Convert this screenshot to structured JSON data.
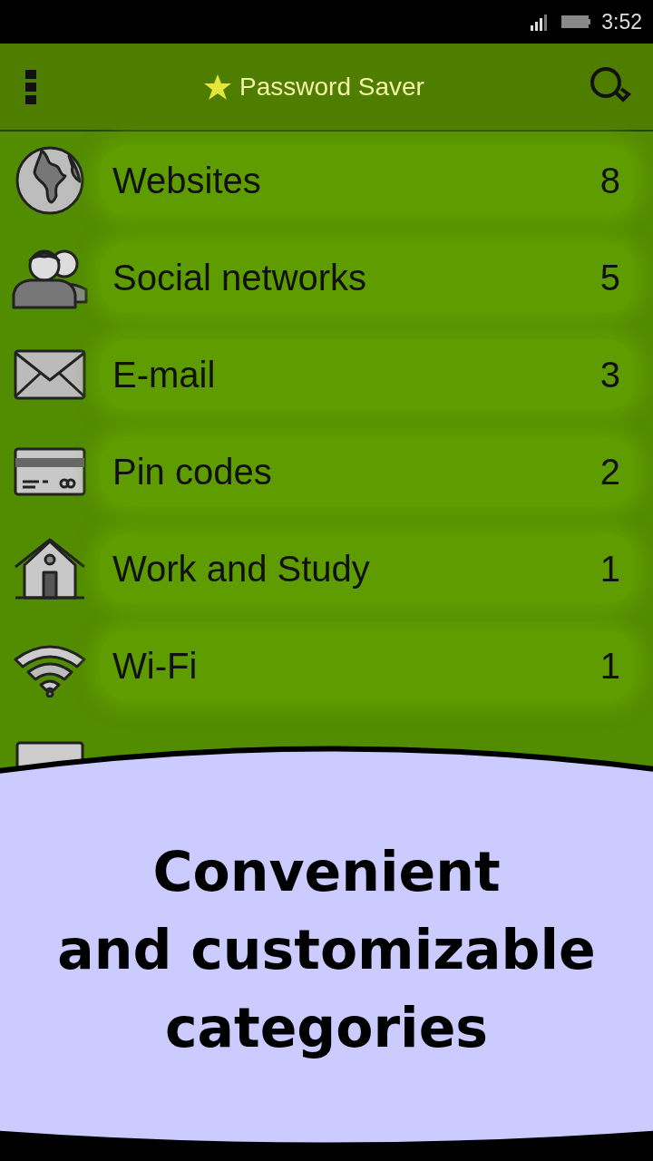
{
  "status_bar": {
    "time": "3:52"
  },
  "app_bar": {
    "title": "Password Saver"
  },
  "categories": [
    {
      "label": "Websites",
      "count": "8"
    },
    {
      "label": "Social networks",
      "count": "5"
    },
    {
      "label": "E-mail",
      "count": "3"
    },
    {
      "label": "Pin codes",
      "count": "2"
    },
    {
      "label": "Work and Study",
      "count": "1"
    },
    {
      "label": "Wi-Fi",
      "count": "1"
    }
  ],
  "banner": {
    "lines": [
      "Convenient",
      "and customizable",
      "categories"
    ]
  }
}
